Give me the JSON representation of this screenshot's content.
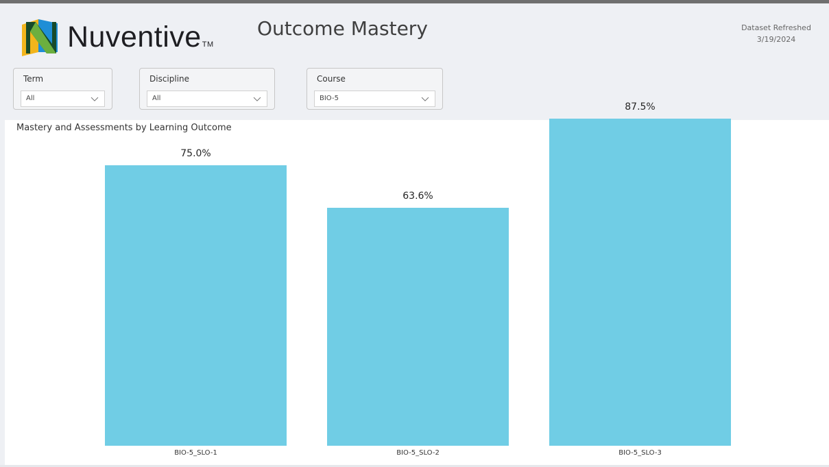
{
  "brand": {
    "name": "Nuventive",
    "tm": "TM"
  },
  "header": {
    "title": "Outcome Mastery"
  },
  "refresh": {
    "label": "Dataset Refreshed",
    "date": "3/19/2024"
  },
  "filters": [
    {
      "label": "Term",
      "value": "All"
    },
    {
      "label": "Discipline",
      "value": "All"
    },
    {
      "label": "Course",
      "value": "BIO-5"
    }
  ],
  "icons": {
    "logo": "nuventive-logo-icon",
    "dropdown": "chevron-down-icon"
  },
  "colors": {
    "bar": "#70cde5",
    "background": "#eef0f4",
    "panel": "#ffffff"
  },
  "chart_data": {
    "type": "bar",
    "title": "Mastery and Assessments by Learning Outcome",
    "categories": [
      "BIO-5_SLO-1",
      "BIO-5_SLO-2",
      "BIO-5_SLO-3"
    ],
    "values": [
      75.0,
      63.6,
      87.5
    ],
    "data_labels": [
      "75.0%",
      "63.6%",
      "87.5%"
    ],
    "ylim": [
      0,
      100
    ],
    "xlabel": "",
    "ylabel": "",
    "grid": false
  }
}
